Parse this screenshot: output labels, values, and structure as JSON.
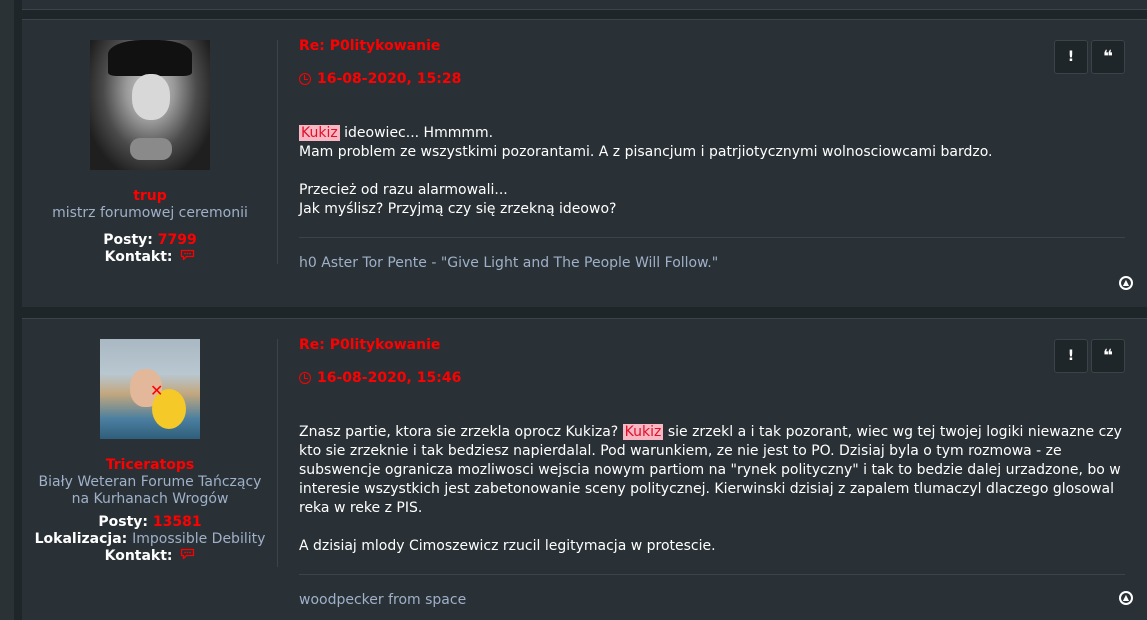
{
  "posts": [
    {
      "author": {
        "username": "trup",
        "rank": "mistrz forumowej ceremonii",
        "posts_label": "Posty:",
        "posts_count": "7799",
        "contact_label": "Kontakt:"
      },
      "title": "Re: P0litykowanie",
      "date": "16-08-2020, 15:28",
      "body": {
        "line1_highlight": "Kukiz",
        "line1_rest": " ideowiec... Hmmmm.",
        "line2": "Mam problem ze wszystkimi pozorantami. A z pisancjum i patrjiotycznymi wolnosciowcami bardzo.",
        "line3": "Przecież od razu alarmowali...",
        "line4": "Jak myślisz? Przyjmą czy się zrzekną ideowo?"
      },
      "signature": "h0 Aster Tor Pente - \"Give Light and The People Will Follow.\""
    },
    {
      "author": {
        "username": "Triceratops",
        "rank": "Biały Weteran Forume Tańczący na Kurhanach Wrogów",
        "posts_label": "Posty:",
        "posts_count": "13581",
        "location_label": "Lokalizacja:",
        "location": "Impossible Debility",
        "contact_label": "Kontakt:"
      },
      "title": "Re: P0litykowanie",
      "date": "16-08-2020, 15:46",
      "body": {
        "p1_before": "Znasz partie, ktora sie zrzekla oprocz Kukiza? ",
        "p1_highlight": "Kukiz",
        "p1_after": " sie zrzekl a i tak pozorant, wiec wg tej twojej logiki niewazne czy kto sie zrzeknie i tak bedziesz napierdalal. Pod warunkiem, ze nie jest to PO. Dzisiaj byla o tym rozmowa - ze subswencje ogranicza mozliwosci wejscia nowym partiom na \"rynek polityczny\" i tak to bedzie dalej urzadzone, bo w interesie wszystkich jest zabetonowanie sceny politycznej. Kierwinski dzisiaj z zapalem tlumaczyl dlaczego glosowal reka w reke z PIS.",
        "p2": "A dzisiaj mlody Cimoszewicz rzucil legitymacja w protescie."
      },
      "signature": "woodpecker from space"
    }
  ],
  "buttons": {
    "report": "!",
    "quote": "❝",
    "top": "▲"
  },
  "icons": {
    "clock": "clock-icon",
    "contact": "speech-bubble-icon",
    "report": "exclamation-icon",
    "quote": "quote-icon",
    "top": "arrow-up-circle-icon"
  },
  "colors": {
    "accent": "#ff0000",
    "highlight_bg": "#f8b7c3",
    "muted_text": "#9fb0c8",
    "panel": "#293136",
    "background": "#1e2629"
  }
}
